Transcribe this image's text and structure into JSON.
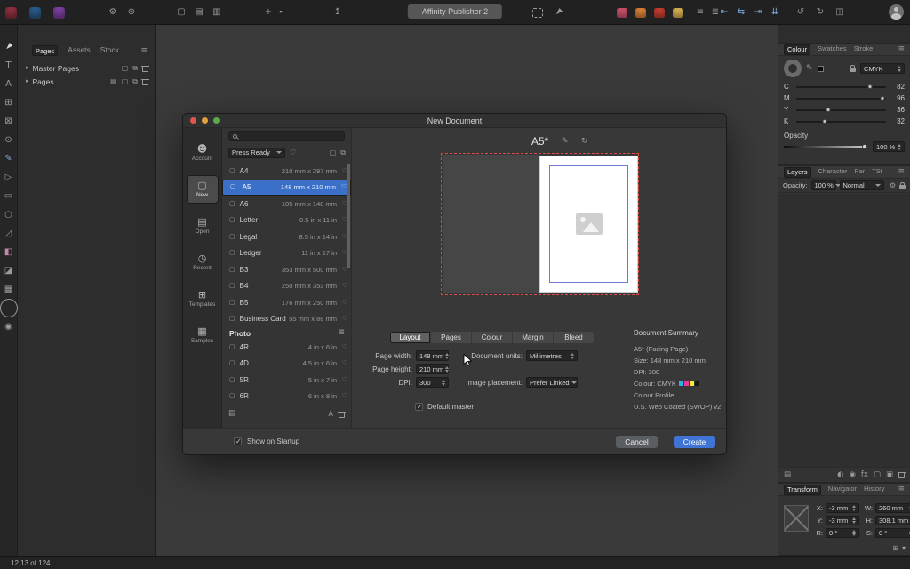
{
  "titlebar": {
    "app_title": "Affinity Publisher 2",
    "app_icons": [
      {
        "name": "affinity-designer-app-icon",
        "cls": "appic",
        "bg": "#8c2f3e"
      },
      {
        "name": "affinity-photo-app-icon",
        "cls": "appic",
        "bg": "#2b5a88"
      },
      {
        "name": "affinity-publisher-app-icon",
        "cls": "appic",
        "bg": "#7b3f9e"
      }
    ],
    "left_icons": [
      {
        "name": "settings-gear-icon",
        "glyph": "⚙"
      },
      {
        "name": "addons-icon",
        "glyph": "⊛"
      }
    ],
    "document_icons": [
      {
        "name": "new-document-icon",
        "glyph": "▢"
      },
      {
        "name": "open-document-icon",
        "glyph": "▤"
      },
      {
        "name": "export-document-icon",
        "glyph": "▥"
      }
    ],
    "insert_icons": [
      {
        "name": "add-content-icon",
        "glyph": "+"
      },
      {
        "name": "add-caret-icon",
        "glyph": "▾",
        "cls": "tiny"
      }
    ],
    "share_icons": [
      {
        "name": "share-icon",
        "glyph": "↥"
      }
    ],
    "mode_icons": [
      {
        "name": "snapping-icon",
        "cls": "dashed-sq"
      },
      {
        "name": "pointer-mode-icon",
        "glyph": "◄",
        "cls": "r45"
      }
    ],
    "persona_icons": [
      {
        "name": "designer-persona-icon",
        "cls": "perso",
        "bg": "#c44f66"
      },
      {
        "name": "photo-persona-icon",
        "cls": "perso",
        "bg": "#cf7a33"
      },
      {
        "name": "publisher-persona-icon",
        "cls": "perso",
        "bg": "#bf3a2d"
      },
      {
        "name": "extra-persona-icon",
        "cls": "perso",
        "bg": "#cfa94e"
      }
    ],
    "list_icons": [
      {
        "name": "studio-presets-icon",
        "glyph": "≡"
      },
      {
        "name": "toolbar-menu-icon",
        "glyph": "≣"
      }
    ],
    "arrange_icons": [
      {
        "name": "align-left-icon",
        "glyph": "⇤",
        "color": "#7ea9de"
      },
      {
        "name": "align-swap-icon",
        "glyph": "⇆",
        "color": "#7ea9de"
      },
      {
        "name": "align-right-icon",
        "glyph": "⇥",
        "color": "#7ea9de"
      },
      {
        "name": "distribute-icon",
        "glyph": "⇊",
        "color": "#7ea9de"
      }
    ],
    "view_icons": [
      {
        "name": "rotate-ccw-icon",
        "glyph": "↺"
      },
      {
        "name": "rotate-cw-icon",
        "glyph": "↻"
      },
      {
        "name": "split-view-icon",
        "glyph": "◫"
      }
    ]
  },
  "tools": [
    {
      "name": "move-tool-icon",
      "glyph": "◄",
      "cls": "r45",
      "color": "#d8d8d8"
    },
    {
      "name": "frame-text-tool-icon",
      "glyph": "T"
    },
    {
      "name": "artistic-text-tool-icon",
      "glyph": "A"
    },
    {
      "name": "table-tool-icon",
      "glyph": "⊞"
    },
    {
      "name": "picture-frame-rectangle-tool-icon",
      "glyph": "⊠"
    },
    {
      "name": "picture-frame-ellipse-tool-icon",
      "glyph": "⊙"
    },
    {
      "name": "pen-tool-icon",
      "glyph": "✎",
      "color": "#86a9d8"
    },
    {
      "name": "node-tool-icon",
      "glyph": "▷"
    },
    {
      "name": "rectangle-tool-icon",
      "glyph": "▭"
    },
    {
      "name": "ellipse-tool-icon",
      "glyph": "○"
    },
    {
      "name": "corner-tool-icon",
      "glyph": "◿"
    },
    {
      "name": "fill-tool-icon",
      "glyph": "◧",
      "color": "#c387a8"
    },
    {
      "name": "transparency-tool-icon",
      "glyph": "◪"
    },
    {
      "name": "vector-crop-tool-icon",
      "glyph": "▦"
    },
    {
      "name": "zoom-tool-icon",
      "cls": "magbig"
    },
    {
      "name": "colour-selector-icon",
      "glyph": "◉"
    }
  ],
  "left_panel": {
    "tabs": [
      {
        "label": "Pages",
        "selected": true
      },
      {
        "label": "Assets"
      },
      {
        "label": "Stock"
      }
    ],
    "master_pages": {
      "label": "Master Pages",
      "icons": [
        {
          "name": "add-master-icon",
          "glyph": "▢"
        },
        {
          "name": "duplicate-master-icon",
          "glyph": "⧉"
        },
        {
          "name": "delete-master-icon",
          "cls": "trash"
        }
      ]
    },
    "pages": {
      "label": "Pages",
      "icons": [
        {
          "name": "page-options-icon",
          "glyph": "▤"
        },
        {
          "name": "add-page-icon",
          "glyph": "▢"
        },
        {
          "name": "duplicate-page-icon",
          "glyph": "⧉"
        },
        {
          "name": "delete-page-icon",
          "cls": "trash"
        }
      ]
    }
  },
  "colour_panel": {
    "tabs": [
      {
        "label": "Colour",
        "selected": true
      },
      {
        "label": "Swatches"
      },
      {
        "label": "Stroke"
      }
    ],
    "model": "CMYK",
    "sliders": [
      {
        "label": "C",
        "value": 82
      },
      {
        "label": "M",
        "value": 96
      },
      {
        "label": "Y",
        "value": 36
      },
      {
        "label": "K",
        "value": 32
      }
    ],
    "opacity_label": "Opacity",
    "opacity_value": "100 %"
  },
  "layers_panel": {
    "tabs": [
      {
        "label": "Layers",
        "selected": true
      },
      {
        "label": "Character"
      },
      {
        "label": "Par"
      },
      {
        "label": "TSt"
      }
    ],
    "opacity_label": "Opacity:",
    "opacity_value": "100 %",
    "blend_mode": "Normal",
    "left_icons": [
      {
        "name": "thumbnail-size-icon",
        "glyph": "▤"
      }
    ],
    "bottom_icons": [
      {
        "name": "mask-layer-icon",
        "glyph": "◐"
      },
      {
        "name": "adjustment-layer-icon",
        "glyph": "◉"
      },
      {
        "name": "fx-icon",
        "glyph": "fx"
      },
      {
        "name": "new-layer-icon",
        "glyph": "▢"
      },
      {
        "name": "new-group-icon",
        "glyph": "▣"
      },
      {
        "name": "delete-layer-icon",
        "cls": "trash"
      }
    ]
  },
  "transform_panel": {
    "tabs": [
      {
        "label": "Transform",
        "selected": true
      },
      {
        "label": "Navigator"
      },
      {
        "label": "History"
      }
    ],
    "fields": [
      {
        "label": "X:",
        "value": "-3 mm"
      },
      {
        "label": "W:",
        "value": "260 mm"
      },
      {
        "label": "Y:",
        "value": "-3 mm"
      },
      {
        "label": "H:",
        "value": "308.1 mm"
      },
      {
        "label": "R:",
        "value": "0 °"
      },
      {
        "label": "S:",
        "value": "0 °"
      }
    ],
    "anchor_icons": [
      {
        "name": "anchor-point-icon",
        "glyph": "⊞"
      },
      {
        "name": "transform-options-icon",
        "glyph": "▾"
      }
    ]
  },
  "dialog": {
    "title": "New Document",
    "sidebar": [
      {
        "label": "Account",
        "glyph": "☻"
      },
      {
        "label": "New",
        "glyph": "▢",
        "selected": true
      },
      {
        "label": "Open",
        "glyph": "▤"
      },
      {
        "label": "Recent",
        "glyph": "◷"
      },
      {
        "label": "Templates",
        "glyph": "⊞"
      },
      {
        "label": "Samples",
        "glyph": "▦"
      }
    ],
    "category": {
      "label": "Press Ready"
    },
    "presets": [
      {
        "name": "A4",
        "size": "210 mm x 297 mm"
      },
      {
        "name": "A5",
        "size": "148 mm x 210 mm",
        "selected": true
      },
      {
        "name": "A6",
        "size": "105 mm x 148 mm"
      },
      {
        "name": "Letter",
        "size": "8.5 in x 11 in"
      },
      {
        "name": "Legal",
        "size": "8.5 in x 14 in"
      },
      {
        "name": "Ledger",
        "size": "11 in x 17 in"
      },
      {
        "name": "B3",
        "size": "353 mm x 500 mm"
      },
      {
        "name": "B4",
        "size": "250 mm x 353 mm"
      },
      {
        "name": "B5",
        "size": "176 mm x 250 mm"
      },
      {
        "name": "Business Card",
        "size": "55 mm x 88 mm"
      },
      {
        "header": "Photo"
      },
      {
        "name": "4R",
        "size": "4 in x 6 in"
      },
      {
        "name": "4D",
        "size": "4.5 in x 6 in"
      },
      {
        "name": "5R",
        "size": "5 in x 7 in"
      },
      {
        "name": "6R",
        "size": "6 in x 8 in"
      }
    ],
    "preview": {
      "title": "A5*"
    },
    "tabs": [
      {
        "label": "Layout",
        "selected": true
      },
      {
        "label": "Pages"
      },
      {
        "label": "Colour"
      },
      {
        "label": "Margin"
      },
      {
        "label": "Bleed"
      }
    ],
    "fields": {
      "page_width_label": "Page width:",
      "page_width": "148 mm",
      "page_height_label": "Page height:",
      "page_height": "210 mm",
      "dpi_label": "DPI:",
      "dpi": "300",
      "units_label": "Document units:",
      "units": "Millimetres",
      "placement_label": "Image placement:",
      "placement": "Prefer Linked",
      "default_master_label": "Default master"
    },
    "summary": {
      "header": "Document Summary",
      "line1": "A5* (Facing Page)",
      "line2": "Size: 148 mm x 210 mm",
      "line3": "DPI: 300",
      "line4": "Colour: CMYK",
      "swatches": [
        "#2bb3e8",
        "#e93a9a",
        "#f6ec3a",
        "#161616"
      ],
      "line5": "Colour Profile:",
      "line6": "U.S. Web Coated (SWOP) v2"
    },
    "footer": {
      "show_on_startup": "Show on Startup",
      "cancel": "Cancel",
      "create": "Create"
    }
  },
  "statusbar": {
    "pages_label": "12,13 of 124",
    "left_icons": [
      {
        "name": "first-page-icon",
        "glyph": "◀",
        "cls": "eL"
      },
      {
        "name": "previous-page-icon",
        "glyph": "◀"
      }
    ],
    "right_icons": [
      {
        "name": "next-page-icon",
        "glyph": "▶"
      },
      {
        "name": "last-page-icon",
        "glyph": "▶",
        "cls": "eR"
      },
      {
        "name": "pages-overview-icon",
        "glyph": "⊞"
      }
    ]
  }
}
